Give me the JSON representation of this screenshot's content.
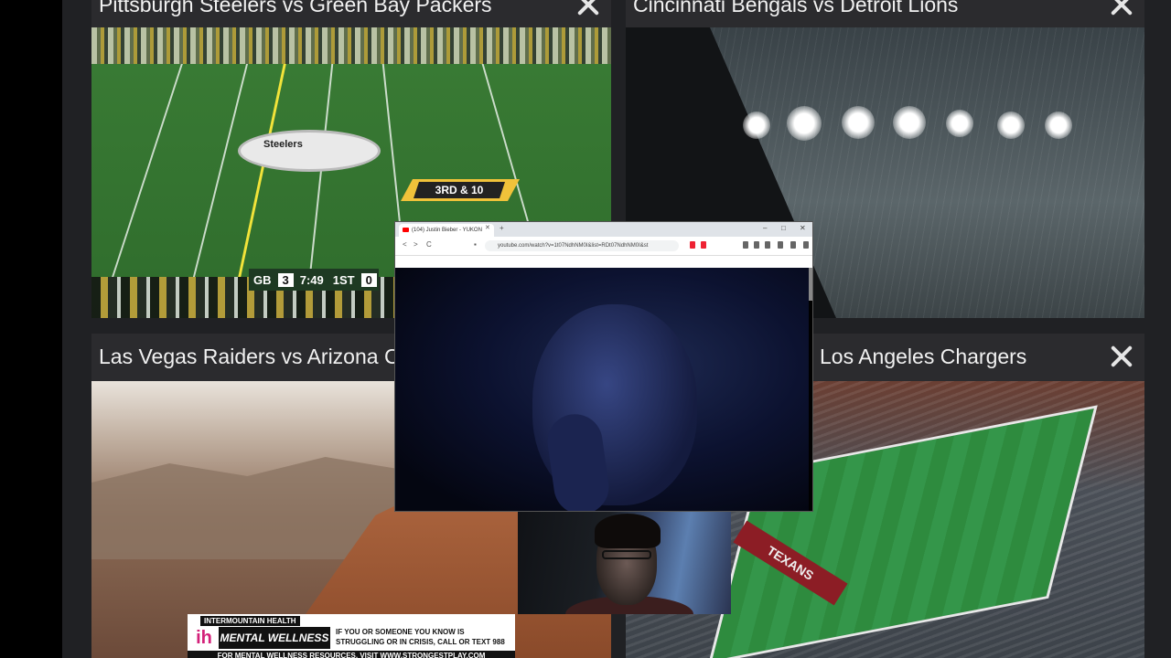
{
  "tiles": [
    {
      "title": "Pittsburgh Steelers vs Green Bay Packers"
    },
    {
      "title": "Cincinnati Bengals vs Detroit Lions"
    },
    {
      "title": "Las Vegas Raiders vs Arizona C"
    },
    {
      "title": "Los Angeles Chargers"
    }
  ],
  "scorebug": {
    "team": "GB",
    "away_score": "3",
    "clock": "7:49",
    "quarter": "1ST",
    "home_score": "0",
    "down_distance": "3RD & 10",
    "field_logo": "Steelers"
  },
  "stadium_endzone": "TEXANS",
  "ad_banner": {
    "top": "INTERMOUNTAIN HEALTH",
    "logo": "ih",
    "title": "MENTAL WELLNESS",
    "message": "IF YOU OR SOMEONE YOU KNOW IS STRUGGLING OR IN CRISIS, CALL OR TEXT 988",
    "footer": "FOR MENTAL WELLNESS RESOURCES, VISIT WWW.STRONGESTPLAY.COM"
  },
  "browser": {
    "tab_title": "(104) Justin Bieber - YUKON",
    "url": "youtube.com/watch?v=1t07NdhNM0I&list=RDt07NdhNM0I&st",
    "new_tab": "+",
    "back": "<",
    "forward": ">",
    "reload": "C"
  },
  "colors": {
    "stage_bg": "#202124",
    "tile_header_bg": "#2b2b2e",
    "title_text": "#f1f1f1",
    "close_icon": "#e6e6e6"
  }
}
